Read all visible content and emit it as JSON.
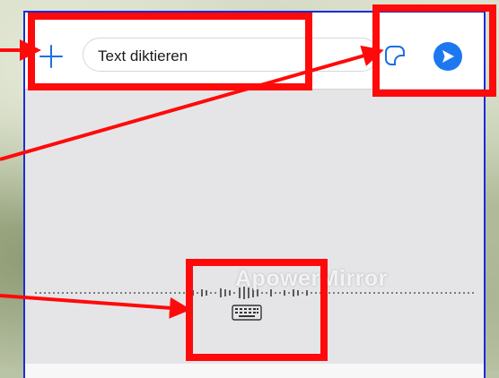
{
  "composer": {
    "input_text": "Text diktieren"
  },
  "dictation": {
    "watermark": "ApowerMirror"
  },
  "icons": {
    "add": "plus-icon",
    "sticker": "sticker-icon",
    "send": "send-icon",
    "keyboard": "keyboard-icon"
  },
  "colors": {
    "accent": "#1d78f0",
    "highlight": "#ff0a0a",
    "frame": "#1a2bd8"
  }
}
